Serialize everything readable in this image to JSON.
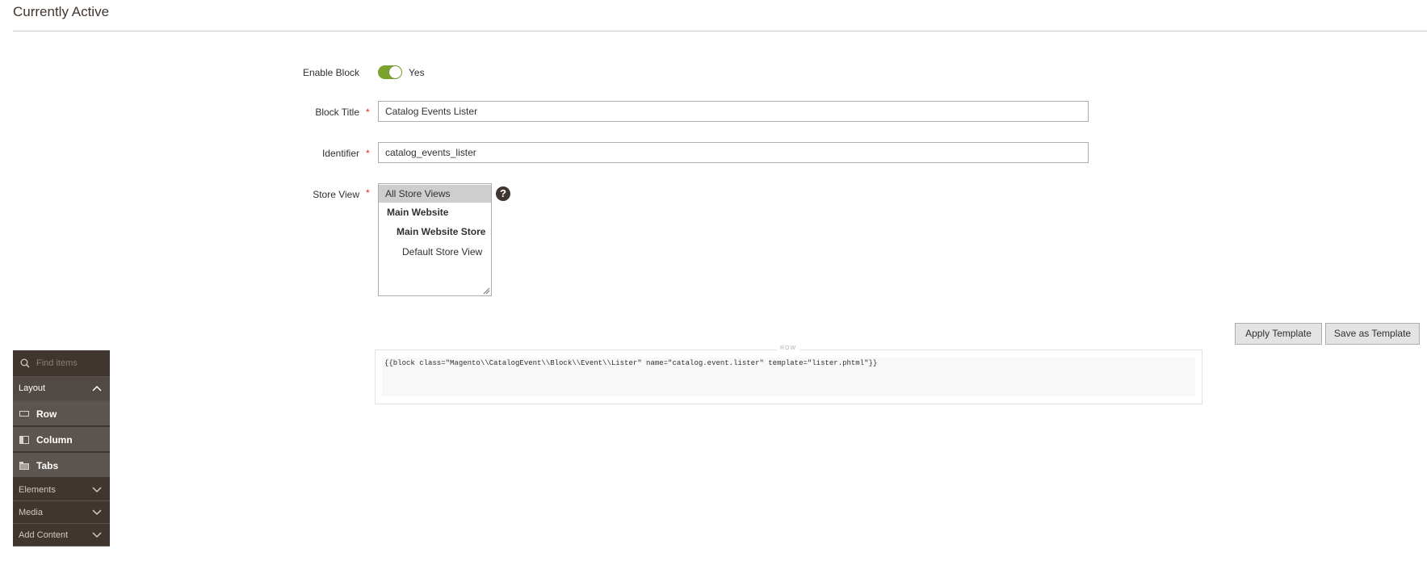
{
  "section": {
    "title": "Currently Active"
  },
  "form": {
    "enable_block": {
      "label": "Enable Block",
      "value": "Yes",
      "enabled": true
    },
    "block_title": {
      "label": "Block Title",
      "required_mark": "*",
      "value": "Catalog Events Lister"
    },
    "identifier": {
      "label": "Identifier",
      "required_mark": "*",
      "value": "catalog_events_lister"
    },
    "store_view": {
      "label": "Store View",
      "required_mark": "*",
      "help": "?",
      "options": [
        {
          "label": "All Store Views",
          "selected": true
        },
        {
          "label": "Main Website",
          "selected": false
        },
        {
          "label": "Main Website Store",
          "selected": false
        },
        {
          "label": "Default Store View",
          "selected": false
        }
      ]
    }
  },
  "toolbar": {
    "apply_template": "Apply Template",
    "save_as_template": "Save as Template"
  },
  "stage": {
    "row_label": "ROW",
    "code": "{{block class=\"Magento\\\\CatalogEvent\\\\Block\\\\Event\\\\Lister\" name=\"catalog.event.lister\" template=\"lister.phtml\"}}"
  },
  "panel": {
    "search_placeholder": "Find items",
    "layout_label": "Layout",
    "layout_items": [
      {
        "label": "Row",
        "icon": "row-icon"
      },
      {
        "label": "Column",
        "icon": "column-icon"
      },
      {
        "label": "Tabs",
        "icon": "tabs-icon"
      }
    ],
    "categories": [
      {
        "label": "Elements"
      },
      {
        "label": "Media"
      },
      {
        "label": "Add Content"
      }
    ]
  },
  "colors": {
    "toggle_on": "#79a22e",
    "panel_bg": "#41362f",
    "required": "#e22626"
  }
}
